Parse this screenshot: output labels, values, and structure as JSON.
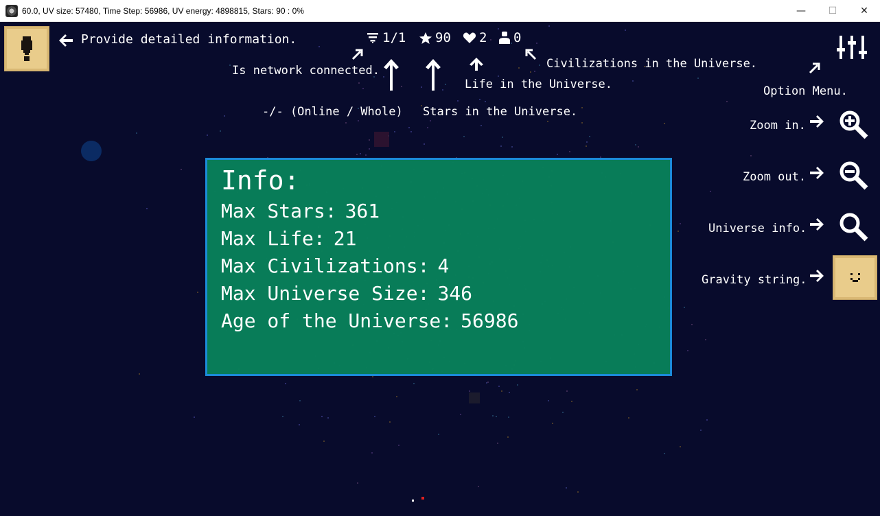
{
  "window": {
    "title": "60.0, UV size: 57480, Time Step: 56986, UV energy: 4898815, Stars: 90 : 0%",
    "minimize_glyph": "—",
    "maximize_glyph": "☐",
    "close_glyph": "✕"
  },
  "hints": {
    "info_button": "Provide detailed information.",
    "network": "Is network connected.",
    "online_whole": "-/- (Online / Whole)",
    "stars": "Stars in the Universe.",
    "life": "Life in the Universe.",
    "civilizations": "Civilizations in the Universe.",
    "option_menu": "Option Menu.",
    "zoom_in": "Zoom in.",
    "zoom_out": "Zoom out.",
    "universe_info": "Universe info.",
    "gravity_string": "Gravity string."
  },
  "status": {
    "network": "1/1",
    "stars": "90",
    "life": "2",
    "civilizations": "0"
  },
  "info_panel": {
    "title": "Info:",
    "rows": [
      {
        "label": "Max Stars:",
        "value": "361"
      },
      {
        "label": "Max Life:",
        "value": "21"
      },
      {
        "label": "Max Civilizations:",
        "value": "4"
      },
      {
        "label": "Max Universe Size:",
        "value": "346"
      },
      {
        "label": "Age of the Universe:",
        "value": "56986"
      }
    ]
  },
  "icons": {
    "info_button": "exclamation-icon",
    "network": "signal-icon",
    "stars": "star-icon",
    "life": "heart-icon",
    "civilizations": "person-icon",
    "option_menu": "sliders-icon",
    "zoom_in": "zoom-in-icon",
    "zoom_out": "zoom-out-icon",
    "universe_info": "magnifier-icon",
    "gravity_string": "chevron-down-icon"
  },
  "colors": {
    "space": "#080b2c",
    "panel": "#08805a",
    "panel_border": "#1b8bd8",
    "button": "#e9cc8b",
    "text": "#ffffff"
  }
}
